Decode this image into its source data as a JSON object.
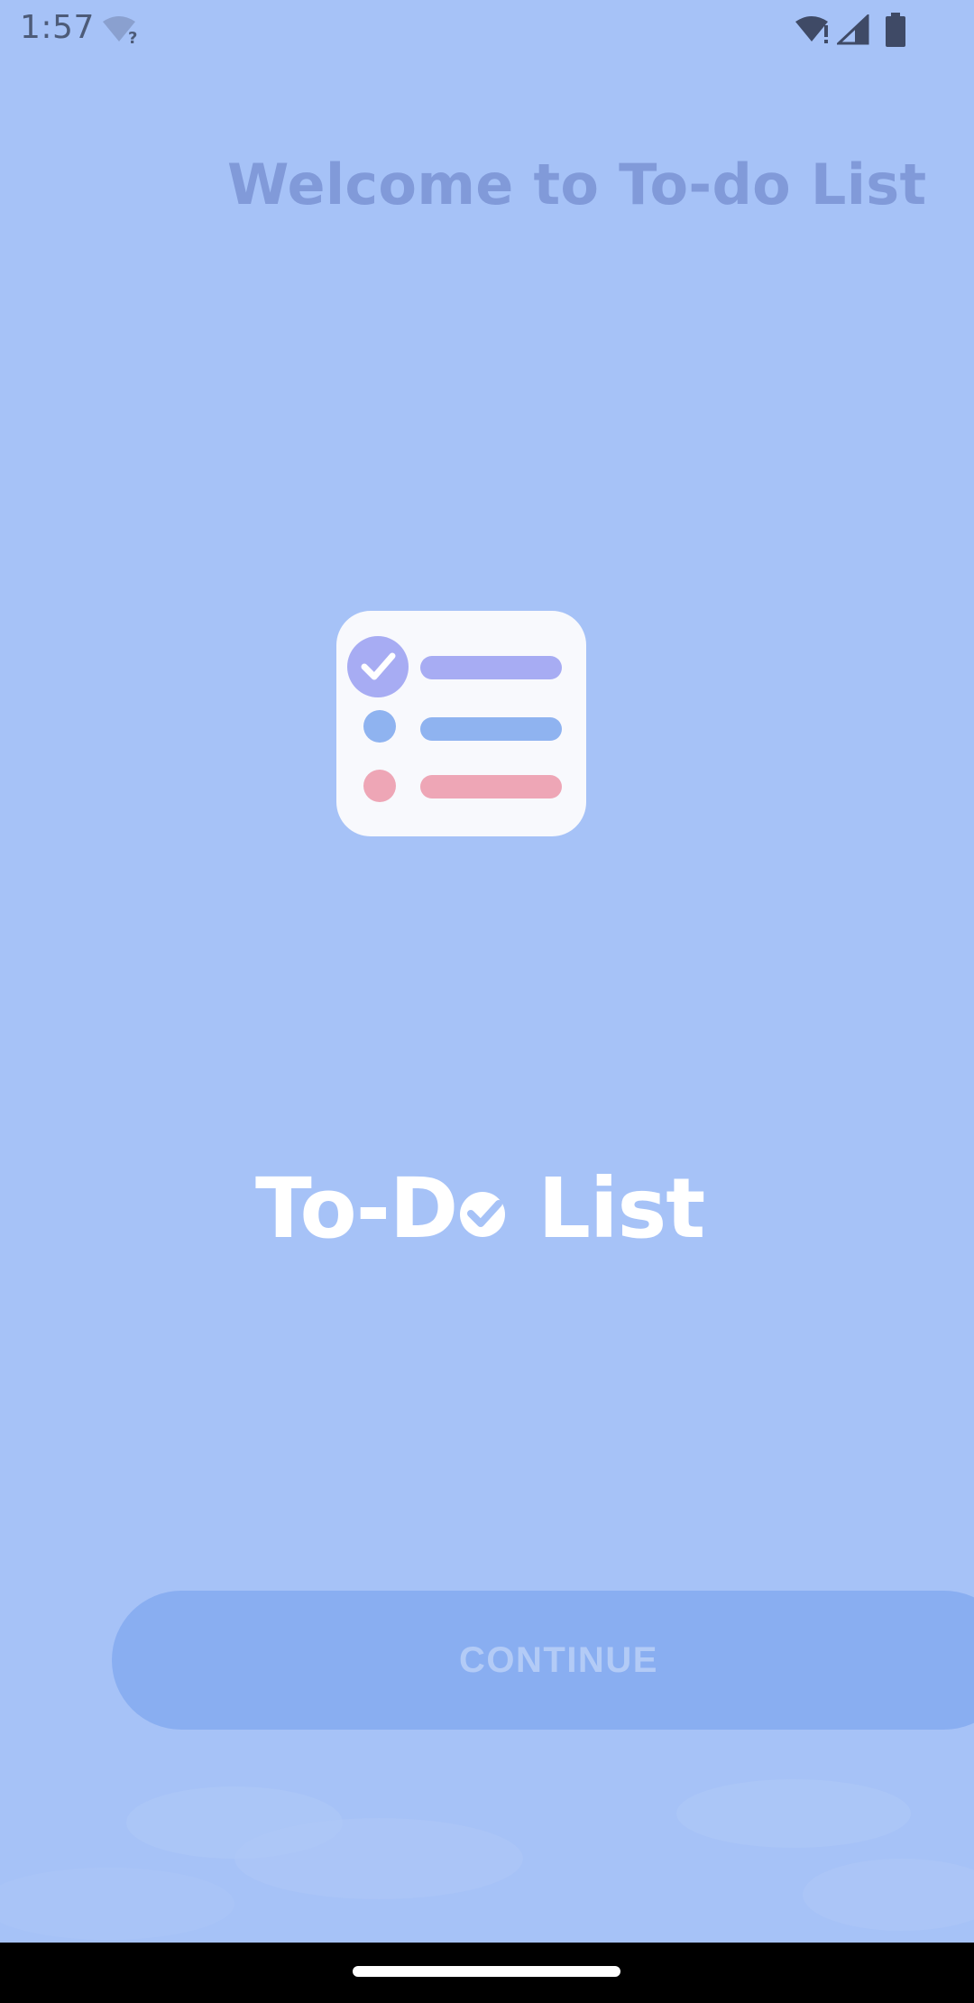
{
  "status_bar": {
    "time": "1:57",
    "icons": [
      "wifi-question-icon",
      "wifi-alert-icon",
      "signal-icon",
      "battery-icon"
    ]
  },
  "welcome": {
    "title": "Welcome to To-do List"
  },
  "logo": {
    "text_before": "To-D",
    "text_after": " List",
    "icon": "checklist-icon"
  },
  "actions": {
    "continue_label": "CONTINUE"
  },
  "colors": {
    "background": "#a6c2f7",
    "title": "#819ad9",
    "button": "#89aef1",
    "button_text": "#b3cbf6",
    "check_purple": "#a7acf3",
    "dot_blue": "#8fb3f0",
    "dot_pink": "#eea6b6"
  }
}
